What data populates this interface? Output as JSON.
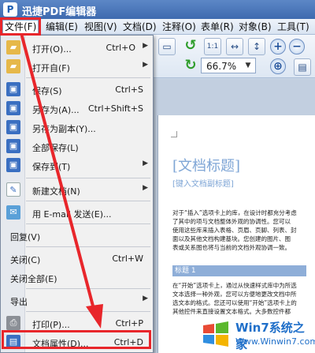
{
  "app": {
    "title": "迅捷PDF编辑器",
    "icon_name": "app-logo-icon"
  },
  "menubar": [
    {
      "label": "文件(F)",
      "active": true
    },
    {
      "label": "编辑(E)"
    },
    {
      "label": "视图(V)"
    },
    {
      "label": "文档(D)"
    },
    {
      "label": "注释(O)"
    },
    {
      "label": "表单(R)"
    },
    {
      "label": "对象(B)"
    },
    {
      "label": "工具(T)"
    }
  ],
  "toolbar": {
    "zoom_value": "66.7%",
    "buttons": [
      "rotate-ccw-icon",
      "rotate-cw-icon",
      "fit-page-icon",
      "fit-width-icon",
      "zoom-in-icon",
      "zoom-out-icon",
      "single-page-icon"
    ]
  },
  "file_menu": {
    "items": [
      {
        "label": "打开(O)...",
        "shortcut": "Ctrl+O",
        "submenu": true,
        "icon": "open-folder-icon"
      },
      {
        "label": "打开自(F)",
        "submenu": true,
        "icon": "open-from-icon"
      },
      {
        "label": "保存(S)",
        "shortcut": "Ctrl+S",
        "icon": "save-icon"
      },
      {
        "label": "另存为(A)...",
        "shortcut": "Ctrl+Shift+S",
        "icon": "save-as-icon"
      },
      {
        "label": "另存为副本(Y)...",
        "icon": "save-copy-icon"
      },
      {
        "label": "全部保存(L)",
        "icon": "save-all-icon"
      },
      {
        "label": "保存到(T)",
        "submenu": true,
        "icon": "save-to-icon"
      },
      {
        "label": "新建文档(N)",
        "submenu": true,
        "icon": "new-document-icon"
      },
      {
        "label": "用 E-mail 发送(E)...",
        "icon": "email-icon"
      },
      {
        "label": "回复(V)"
      },
      {
        "label": "关闭(C)",
        "shortcut": "Ctrl+W"
      },
      {
        "label": "关闭全部(E)"
      },
      {
        "label": "导出",
        "submenu": true
      },
      {
        "label": "打印(P)...",
        "shortcut": "Ctrl+P",
        "icon": "print-icon"
      },
      {
        "label": "文档属性(D)...",
        "shortcut": "Ctrl+D",
        "icon": "document-properties-icon",
        "highlighted": true
      }
    ]
  },
  "document": {
    "title": "[文档标题]",
    "subtitle": "[键入文档副标题]",
    "paragraph1": [
      "对于“插入”选项卡上的库，在设计时都充分考虑",
      "了其中的项与文档整体外观的协调性。您可以",
      "使用这些库来插入表格、页眉、页脚、列表、封",
      "面以及其他文档构建基块。您创建的图片、图",
      "表或关系图也将与当前的文档外观协调一致。"
    ],
    "heading": "标题 1",
    "paragraph2": [
      "在“开始”选项卡上，通过从快速样式库中为所选",
      "文本选择一种外观，您可以方便地更改文档中所",
      "选文本的格式。您还可以使用“开始”选项卡上的",
      "其他控件来直接设置文本格式。大多数控件都"
    ]
  },
  "watermark": {
    "line1": "Win7系统之家",
    "line2": "Www.Winwin7.com"
  },
  "colors": {
    "highlight": "#e8262b",
    "title_bar": "#3e6aaf",
    "accent_blue": "#1f6fc9"
  }
}
